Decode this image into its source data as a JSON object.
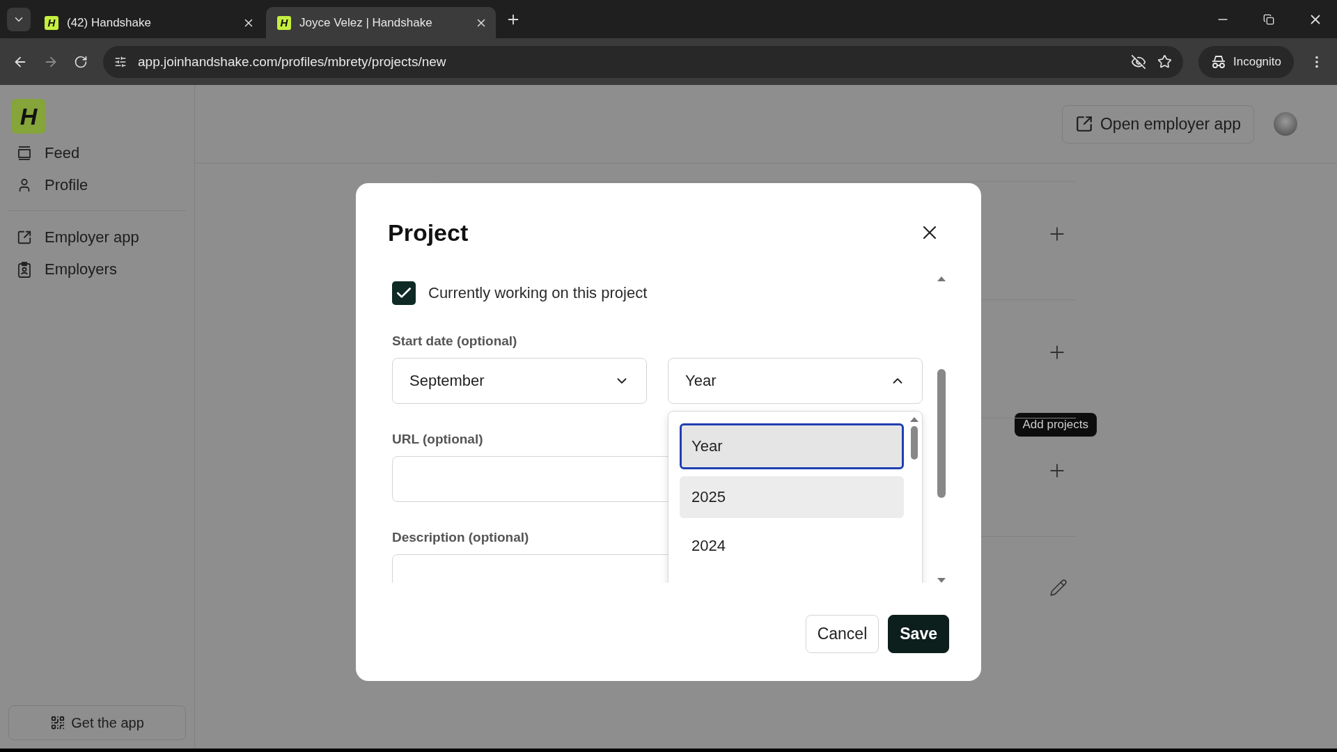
{
  "browser": {
    "tabs": [
      {
        "favicon_letter": "H",
        "title": "(42) Handshake",
        "selected": false
      },
      {
        "favicon_letter": "H",
        "title": "Joyce Velez | Handshake",
        "selected": true
      }
    ],
    "url": "app.joinhandshake.com/profiles/mbrety/projects/new",
    "incognito_label": "Incognito"
  },
  "sidebar": {
    "logo_letter": "H",
    "groups": [
      [
        {
          "label": "Feed"
        },
        {
          "label": "Profile"
        }
      ],
      [
        {
          "label": "Employer app"
        },
        {
          "label": "Employers"
        }
      ]
    ],
    "get_app_button": "Get the app"
  },
  "header": {
    "open_employer_button": "Open employer app"
  },
  "profile_rows": [
    {
      "kind": "add"
    },
    {
      "kind": "add",
      "tooltip": "Add projects"
    },
    {
      "kind": "add"
    },
    {
      "kind": "edit"
    }
  ],
  "modal": {
    "title": "Project",
    "checkbox": {
      "label": "Currently working on this project",
      "checked": true
    },
    "start_date_label": "Start date (optional)",
    "month_select": {
      "value": "September",
      "expanded": false
    },
    "year_select": {
      "value": "Year",
      "expanded": true
    },
    "year_options": [
      {
        "label": "Year",
        "selected": true,
        "hovered": false
      },
      {
        "label": "2025",
        "selected": false,
        "hovered": true
      },
      {
        "label": "2024",
        "selected": false,
        "hovered": false
      }
    ],
    "url_label": "URL (optional)",
    "description_label": "Description (optional)",
    "buttons": {
      "cancel": "Cancel",
      "save": "Save"
    }
  }
}
